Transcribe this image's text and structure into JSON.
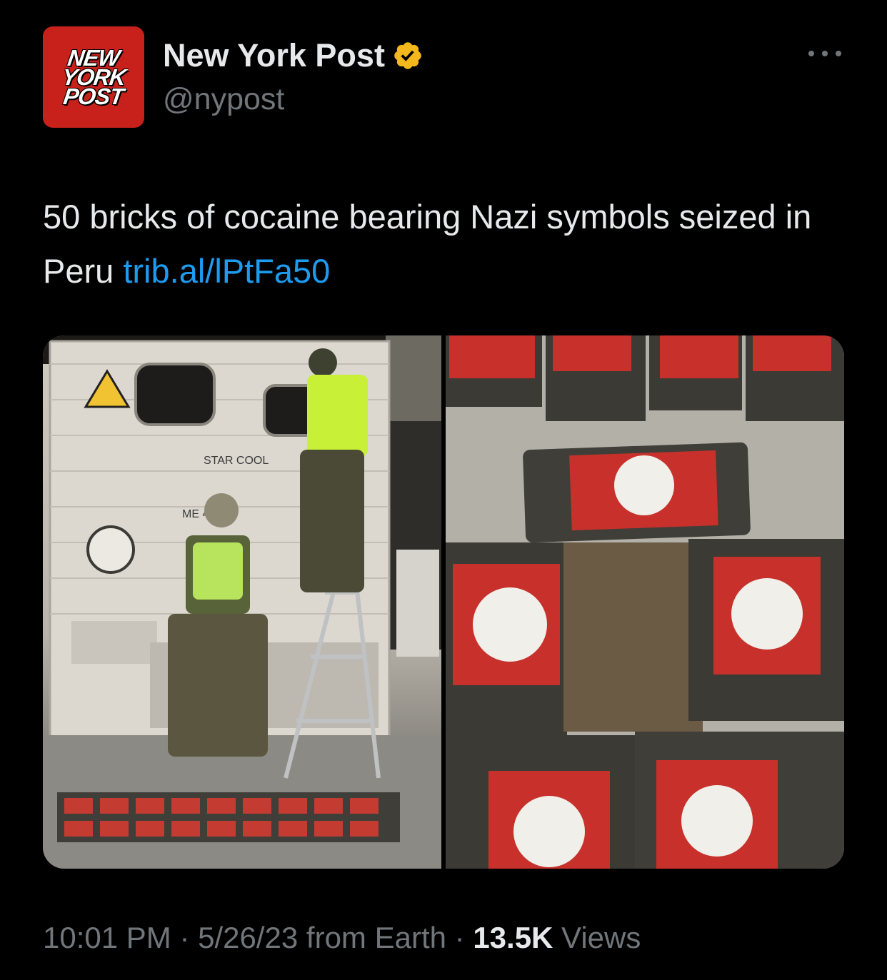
{
  "author": {
    "avatar_lines": [
      "NEW",
      "YORK",
      "POST"
    ],
    "name": "New York Post",
    "handle": "@nypost",
    "verified": true,
    "avatar_color": "#c8211b",
    "verified_color": "#f4b81c"
  },
  "tweet": {
    "text": "50 bricks of cocaine bearing Nazi symbols seized in Peru ",
    "link": "trib.al/lPtFa50",
    "link_color": "#1d9bf0"
  },
  "media": {
    "photos": [
      {
        "name": "photo-officers-at-container"
      },
      {
        "name": "photo-wrapped-bricks-closeup"
      }
    ]
  },
  "footer": {
    "time": "10:01 PM",
    "separator": " · ",
    "date": "5/26/23",
    "source": " from Earth",
    "views_count": "13.5K",
    "views_label": " Views"
  }
}
